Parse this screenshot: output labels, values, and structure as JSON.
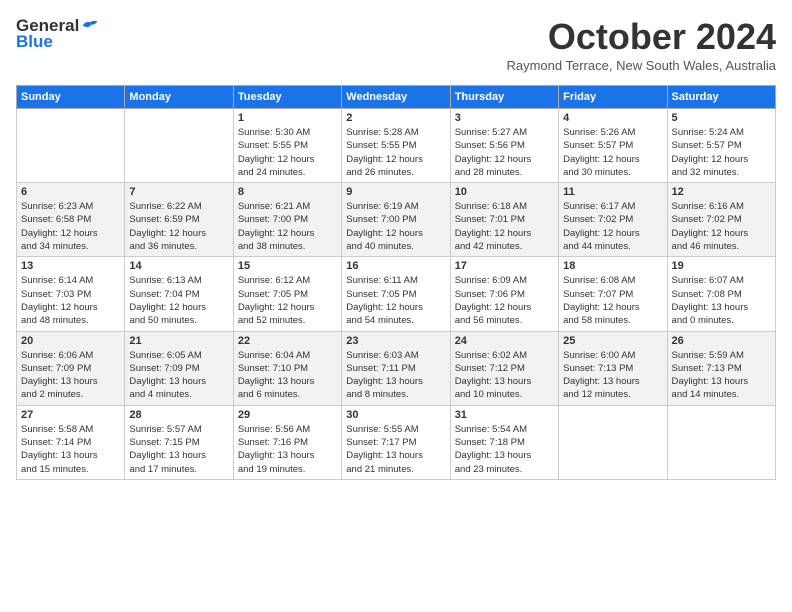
{
  "logo": {
    "general": "General",
    "blue": "Blue"
  },
  "title": "October 2024",
  "subtitle": "Raymond Terrace, New South Wales, Australia",
  "days_header": [
    "Sunday",
    "Monday",
    "Tuesday",
    "Wednesday",
    "Thursday",
    "Friday",
    "Saturday"
  ],
  "weeks": [
    [
      {
        "day": "",
        "info": ""
      },
      {
        "day": "",
        "info": ""
      },
      {
        "day": "1",
        "info": "Sunrise: 5:30 AM\nSunset: 5:55 PM\nDaylight: 12 hours\nand 24 minutes."
      },
      {
        "day": "2",
        "info": "Sunrise: 5:28 AM\nSunset: 5:55 PM\nDaylight: 12 hours\nand 26 minutes."
      },
      {
        "day": "3",
        "info": "Sunrise: 5:27 AM\nSunset: 5:56 PM\nDaylight: 12 hours\nand 28 minutes."
      },
      {
        "day": "4",
        "info": "Sunrise: 5:26 AM\nSunset: 5:57 PM\nDaylight: 12 hours\nand 30 minutes."
      },
      {
        "day": "5",
        "info": "Sunrise: 5:24 AM\nSunset: 5:57 PM\nDaylight: 12 hours\nand 32 minutes."
      }
    ],
    [
      {
        "day": "6",
        "info": "Sunrise: 6:23 AM\nSunset: 6:58 PM\nDaylight: 12 hours\nand 34 minutes."
      },
      {
        "day": "7",
        "info": "Sunrise: 6:22 AM\nSunset: 6:59 PM\nDaylight: 12 hours\nand 36 minutes."
      },
      {
        "day": "8",
        "info": "Sunrise: 6:21 AM\nSunset: 7:00 PM\nDaylight: 12 hours\nand 38 minutes."
      },
      {
        "day": "9",
        "info": "Sunrise: 6:19 AM\nSunset: 7:00 PM\nDaylight: 12 hours\nand 40 minutes."
      },
      {
        "day": "10",
        "info": "Sunrise: 6:18 AM\nSunset: 7:01 PM\nDaylight: 12 hours\nand 42 minutes."
      },
      {
        "day": "11",
        "info": "Sunrise: 6:17 AM\nSunset: 7:02 PM\nDaylight: 12 hours\nand 44 minutes."
      },
      {
        "day": "12",
        "info": "Sunrise: 6:16 AM\nSunset: 7:02 PM\nDaylight: 12 hours\nand 46 minutes."
      }
    ],
    [
      {
        "day": "13",
        "info": "Sunrise: 6:14 AM\nSunset: 7:03 PM\nDaylight: 12 hours\nand 48 minutes."
      },
      {
        "day": "14",
        "info": "Sunrise: 6:13 AM\nSunset: 7:04 PM\nDaylight: 12 hours\nand 50 minutes."
      },
      {
        "day": "15",
        "info": "Sunrise: 6:12 AM\nSunset: 7:05 PM\nDaylight: 12 hours\nand 52 minutes."
      },
      {
        "day": "16",
        "info": "Sunrise: 6:11 AM\nSunset: 7:05 PM\nDaylight: 12 hours\nand 54 minutes."
      },
      {
        "day": "17",
        "info": "Sunrise: 6:09 AM\nSunset: 7:06 PM\nDaylight: 12 hours\nand 56 minutes."
      },
      {
        "day": "18",
        "info": "Sunrise: 6:08 AM\nSunset: 7:07 PM\nDaylight: 12 hours\nand 58 minutes."
      },
      {
        "day": "19",
        "info": "Sunrise: 6:07 AM\nSunset: 7:08 PM\nDaylight: 13 hours\nand 0 minutes."
      }
    ],
    [
      {
        "day": "20",
        "info": "Sunrise: 6:06 AM\nSunset: 7:09 PM\nDaylight: 13 hours\nand 2 minutes."
      },
      {
        "day": "21",
        "info": "Sunrise: 6:05 AM\nSunset: 7:09 PM\nDaylight: 13 hours\nand 4 minutes."
      },
      {
        "day": "22",
        "info": "Sunrise: 6:04 AM\nSunset: 7:10 PM\nDaylight: 13 hours\nand 6 minutes."
      },
      {
        "day": "23",
        "info": "Sunrise: 6:03 AM\nSunset: 7:11 PM\nDaylight: 13 hours\nand 8 minutes."
      },
      {
        "day": "24",
        "info": "Sunrise: 6:02 AM\nSunset: 7:12 PM\nDaylight: 13 hours\nand 10 minutes."
      },
      {
        "day": "25",
        "info": "Sunrise: 6:00 AM\nSunset: 7:13 PM\nDaylight: 13 hours\nand 12 minutes."
      },
      {
        "day": "26",
        "info": "Sunrise: 5:59 AM\nSunset: 7:13 PM\nDaylight: 13 hours\nand 14 minutes."
      }
    ],
    [
      {
        "day": "27",
        "info": "Sunrise: 5:58 AM\nSunset: 7:14 PM\nDaylight: 13 hours\nand 15 minutes."
      },
      {
        "day": "28",
        "info": "Sunrise: 5:57 AM\nSunset: 7:15 PM\nDaylight: 13 hours\nand 17 minutes."
      },
      {
        "day": "29",
        "info": "Sunrise: 5:56 AM\nSunset: 7:16 PM\nDaylight: 13 hours\nand 19 minutes."
      },
      {
        "day": "30",
        "info": "Sunrise: 5:55 AM\nSunset: 7:17 PM\nDaylight: 13 hours\nand 21 minutes."
      },
      {
        "day": "31",
        "info": "Sunrise: 5:54 AM\nSunset: 7:18 PM\nDaylight: 13 hours\nand 23 minutes."
      },
      {
        "day": "",
        "info": ""
      },
      {
        "day": "",
        "info": ""
      }
    ]
  ]
}
